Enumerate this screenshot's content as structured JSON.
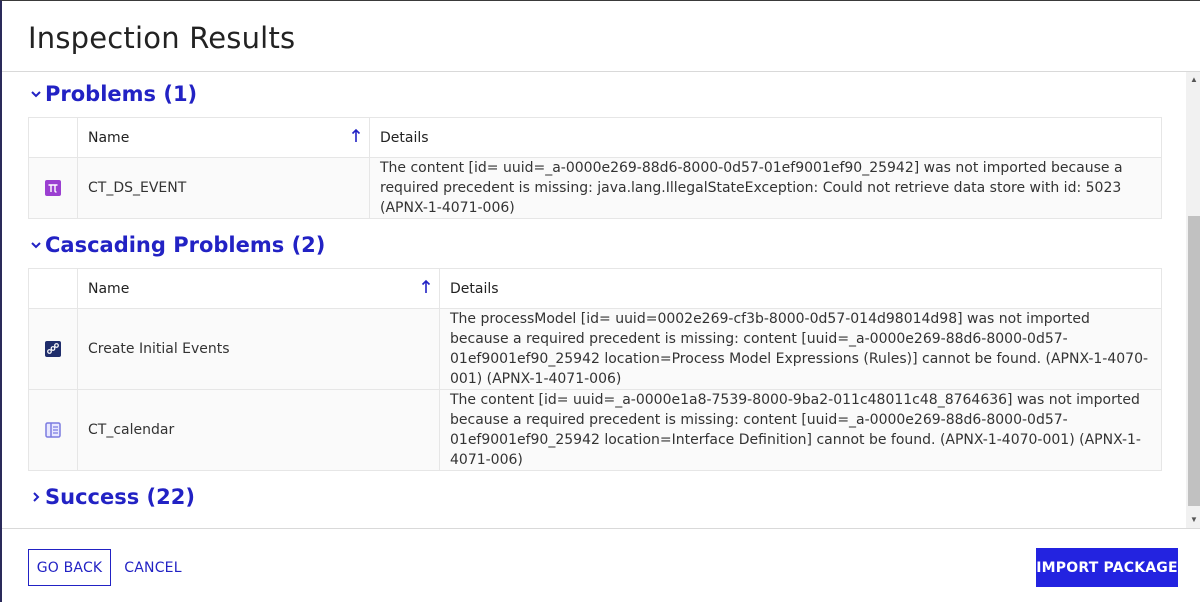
{
  "dialog": {
    "title": "Inspection Results"
  },
  "sections": {
    "problems": {
      "title": "Problems (1)",
      "expanded": true,
      "columns": {
        "name": "Name",
        "details": "Details"
      },
      "rows": [
        {
          "icon": "pi-icon",
          "name": "CT_DS_EVENT",
          "details": "The content [id= uuid=_a-0000e269-88d6-8000-0d57-01ef9001ef90_25942] was not imported because a required precedent is missing: java.lang.IllegalStateException: Could not retrieve data store with id: 5023 (APNX-1-4071-006)"
        }
      ]
    },
    "cascading": {
      "title": "Cascading Problems (2)",
      "expanded": true,
      "columns": {
        "name": "Name",
        "details": "Details"
      },
      "rows": [
        {
          "icon": "process-model-icon",
          "name": "Create Initial Events",
          "details": "The processModel [id= uuid=0002e269-cf3b-8000-0d57-014d98014d98] was not imported because a required precedent is missing: content [uuid=_a-0000e269-88d6-8000-0d57-01ef9001ef90_25942 location=Process Model Expressions (Rules)] cannot be found. (APNX-1-4070-001) (APNX-1-4071-006)"
        },
        {
          "icon": "interface-icon",
          "name": "CT_calendar",
          "details": "The content [id= uuid=_a-0000e1a8-7539-8000-9ba2-011c48011c48_8764636] was not imported because a required precedent is missing: content [uuid=_a-0000e269-88d6-8000-0d57-01ef9001ef90_25942 location=Interface Definition] cannot be found. (APNX-1-4070-001) (APNX-1-4071-006)"
        }
      ]
    },
    "success": {
      "title": "Success (22)",
      "expanded": false
    }
  },
  "footer": {
    "go_back": "GO BACK",
    "cancel": "CANCEL",
    "import": "IMPORT PACKAGE"
  },
  "colors": {
    "accent": "#2222c4",
    "primary_button": "#2323e0",
    "icon_purple": "#9b3fd1",
    "icon_navy": "#1f2d6b",
    "icon_lavender": "#7b7be0"
  }
}
